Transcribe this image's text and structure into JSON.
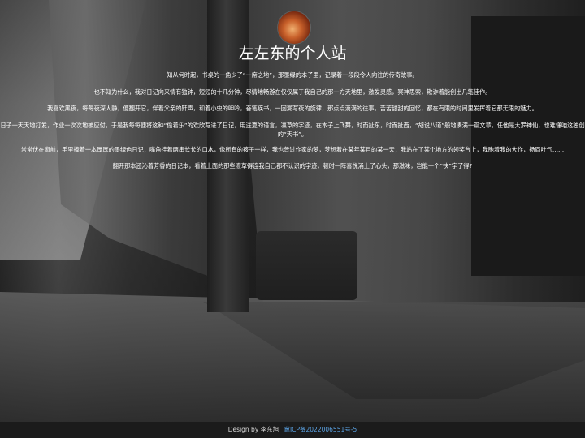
{
  "site": {
    "title": "左左东的个人站",
    "avatar_icon": "avatar-image"
  },
  "paragraphs": [
    "知从何时起，书桌的一角少了“一席之地”，那墨绿的本子里，记录着一段段令人向往的传奇故事。",
    "也不知为什么，我对日记向来情有独钟，短短的十几分钟，尽情地畅游在仅仅属于我自己的那一方天地里，激发灵感，冥神思索，欺诈着能创出几笔佳作。",
    "我喜欢黑夜，每每夜深人静，便翻开它，伴着父亲的鼾声，和着小虫的呻吟，奋笔疾书，一回溯写夜的旋律，那点点滴滴的往事，苦苦甜甜的回忆，都在有限的时间里发挥着它那无限的魅力。",
    "日子一天天地打发，作业一次次地被应付，于是我每每便将这种“偷着乐”的欢欣写进了日记，用送夏的语言，凛草的字迹，在本子上飞舞，时而扯东，时而扯西，“胡说八道”般地凑满一篇文章，任他是大罗神仙，也难懂咱这独创的“天书”。",
    "常常伏在窗前，手里捧着一本厚厚的墨绿色日记，嘴角挂着两串长长的口水，像所有的孩子一样，我也曾过作家的梦，梦想着在某年某月的某一天，我站在了某个地方的领奖台上，我胞着我的大作，扬眉吐气……",
    "翻开那本还沁着芳香的日记本，看着上面的那些潦草得连我自己都不认识的字迹，顿时一阵喜悦涌上了心头，那滋味，岂能一个“快”字了得?"
  ],
  "footer": {
    "design_by": "Design by 李东旭",
    "icp_link": "冀ICP备2022006551号-5"
  }
}
